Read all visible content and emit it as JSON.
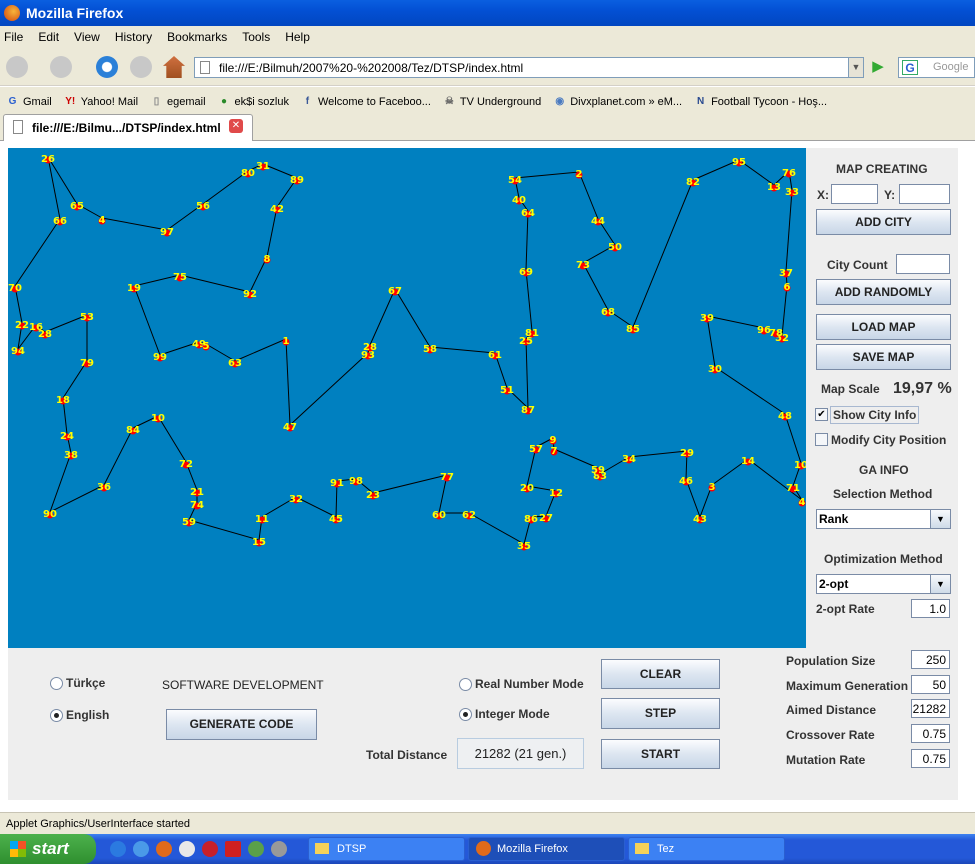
{
  "window": {
    "title": "Mozilla Firefox"
  },
  "menu": [
    "File",
    "Edit",
    "View",
    "History",
    "Bookmarks",
    "Tools",
    "Help"
  ],
  "navbar": {
    "url": "file:///E:/Bilmuh/2007%20-%202008/Tez/DTSP/index.html",
    "search_placeholder": "Google"
  },
  "bookmarks": [
    {
      "label": "Gmail",
      "icon": "google-icon"
    },
    {
      "label": "Yahoo! Mail",
      "icon": "yahoo-icon"
    },
    {
      "label": "egemail",
      "icon": "page-icon"
    },
    {
      "label": "ek$i sozluk",
      "icon": "drop-icon"
    },
    {
      "label": "Welcome to Faceboo...",
      "icon": "facebook-icon"
    },
    {
      "label": "TV Underground",
      "icon": "skull-icon"
    },
    {
      "label": "Divxplanet.com » eM...",
      "icon": "globe-icon"
    },
    {
      "label": "Football Tycoon - Hoş...",
      "icon": "n-icon"
    }
  ],
  "tab": {
    "title": "file:///E:/Bilmu.../DTSP/index.html"
  },
  "map": {
    "background": "#0080c0",
    "city_color": "#ff0000",
    "label_color": "#ffff00",
    "tour": [
      "26",
      "65",
      "4",
      "97",
      "56",
      "80",
      "31",
      "89",
      "42",
      "8",
      "92",
      "75",
      "19",
      "99",
      "49",
      "5",
      "63",
      "1",
      "47",
      "93",
      "28",
      "67",
      "58",
      "61",
      "51",
      "87",
      "25",
      "81",
      "69",
      "64",
      "40",
      "54",
      "2",
      "44",
      "50",
      "73",
      "68",
      "85",
      "82",
      "95",
      "13",
      "76",
      "33",
      "37",
      "6",
      "52",
      "78",
      "96",
      "39",
      "30",
      "48",
      "10",
      "71",
      "4",
      "14",
      "3",
      "43",
      "46",
      "29",
      "34",
      "83",
      "59",
      "7",
      "9",
      "57",
      "20",
      "12",
      "27",
      "86",
      "35",
      "62",
      "60",
      "77",
      "23",
      "98",
      "91",
      "45",
      "32",
      "11",
      "15",
      "59",
      "74",
      "21",
      "72",
      "10",
      "84",
      "36",
      "90",
      "38",
      "24",
      "18",
      "79",
      "53",
      "28",
      "16",
      "94",
      "22",
      "70",
      "66"
    ]
  },
  "panel": {
    "map_creating": "MAP CREATING",
    "x_label": "X:",
    "y_label": "Y:",
    "x_value": "",
    "y_value": "",
    "add_city": "ADD CITY",
    "city_count_label": "City Count",
    "city_count_value": "",
    "add_randomly": "ADD RANDOMLY",
    "load_map": "LOAD MAP",
    "save_map": "SAVE MAP",
    "map_scale_label": "Map Scale",
    "map_scale_value": "19,97 %",
    "show_city_info": "Show City Info",
    "show_city_info_checked": true,
    "modify_city_position": "Modify City Position",
    "modify_city_position_checked": false,
    "ga_info": "GA INFO",
    "selection_method_label": "Selection Method",
    "selection_method": "Rank",
    "optimization_method_label": "Optimization Method",
    "optimization_method": "2-opt",
    "opt_rate_label": "2-opt Rate",
    "opt_rate": "1.0"
  },
  "bottom": {
    "lang_turkish": "Türkçe",
    "lang_english": "English",
    "language_selected": "English",
    "software_development": "SOFTWARE DEVELOPMENT",
    "generate_code": "GENERATE CODE",
    "real_mode": "Real Number Mode",
    "integer_mode": "Integer Mode",
    "mode_selected": "Integer Mode",
    "total_distance_label": "Total Distance",
    "total_distance": "21282 (21 gen.)",
    "clear": "CLEAR",
    "step": "STEP",
    "start": "START",
    "params": [
      {
        "label": "Population Size",
        "value": "250"
      },
      {
        "label": "Maximum Generation",
        "value": "50"
      },
      {
        "label": "Aimed Distance",
        "value": "21282"
      },
      {
        "label": "Crossover Rate",
        "value": "0.75"
      },
      {
        "label": "Mutation Rate",
        "value": "0.75"
      }
    ]
  },
  "status": "Applet Graphics/UserInterface started",
  "taskbar": {
    "start": "start",
    "tasks": [
      "DTSP",
      "Mozilla Firefox",
      "Tez"
    ],
    "active": "Mozilla Firefox"
  }
}
